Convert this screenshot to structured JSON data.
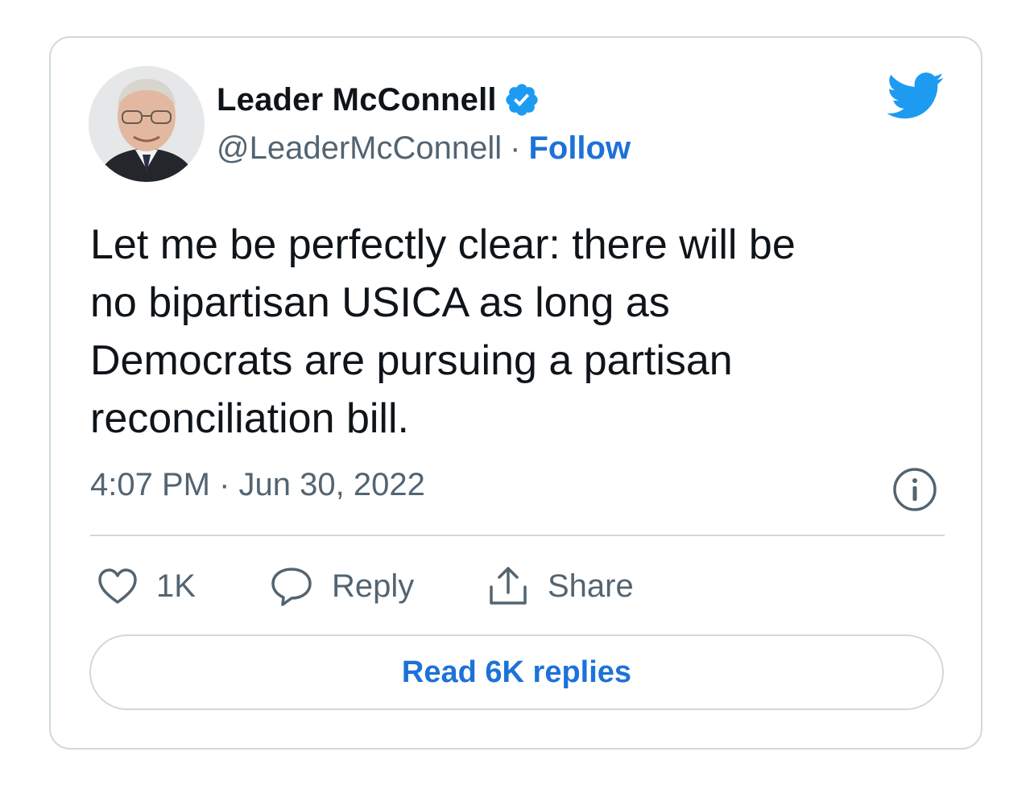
{
  "author": {
    "display_name": "Leader McConnell",
    "handle": "@LeaderMcConnell",
    "separator": "·",
    "follow_label": "Follow",
    "verified": true
  },
  "tweet": {
    "text": "Let me be perfectly clear: there will be\nno bipartisan USICA as long as\nDemocrats are pursuing a partisan\nreconciliation bill.",
    "timestamp": "4:07 PM · Jun 30, 2022"
  },
  "actions": {
    "like_count": "1K",
    "reply_label": "Reply",
    "share_label": "Share"
  },
  "read_replies_label": "Read 6K replies",
  "icons": {
    "brand": "twitter-bird-icon",
    "verified": "verified-badge-icon",
    "info": "info-icon",
    "like": "heart-icon",
    "reply": "speech-bubble-icon",
    "share": "share-upload-icon"
  },
  "colors": {
    "link_blue": "#1d72d8",
    "twitter_blue": "#1d9bf0",
    "muted_text": "#536471",
    "border": "#cfd9de"
  }
}
